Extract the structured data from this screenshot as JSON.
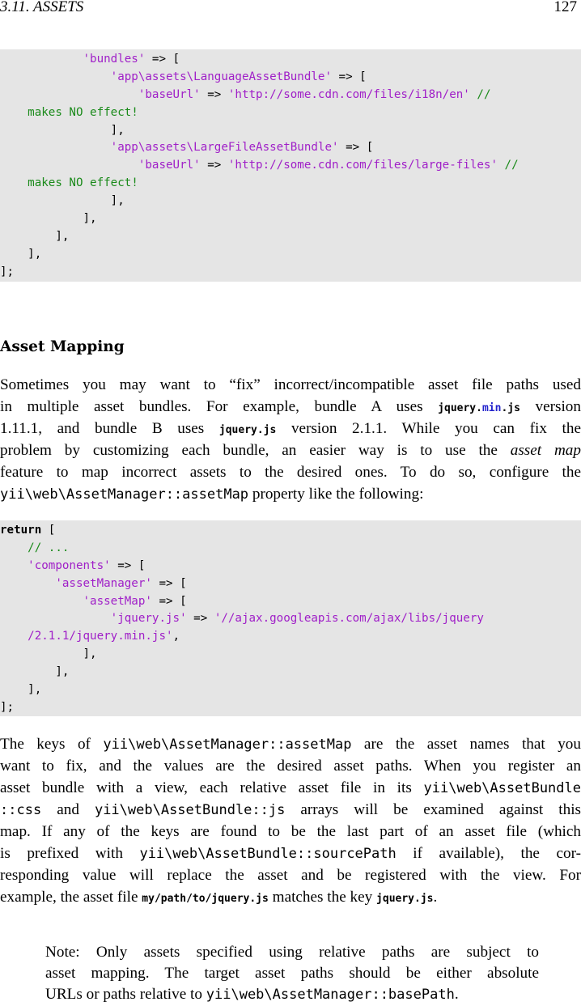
{
  "header": {
    "section": "3.11. ASSETS",
    "page": "127"
  },
  "code1": [
    {
      "segs": [
        {
          "t": "            "
        },
        {
          "t": "'bundles'",
          "c": "str"
        },
        {
          "t": " => ["
        }
      ]
    },
    {
      "segs": [
        {
          "t": "                "
        },
        {
          "t": "'app\\assets\\LanguageAssetBundle'",
          "c": "str"
        },
        {
          "t": " => ["
        }
      ]
    },
    {
      "segs": [
        {
          "t": "                    "
        },
        {
          "t": "'baseUrl'",
          "c": "str"
        },
        {
          "t": " => "
        },
        {
          "t": "'http://some.cdn.com/files/i18n/en'",
          "c": "str"
        },
        {
          "t": " //",
          "c": "cmt"
        }
      ]
    },
    {
      "segs": [
        {
          "t": "    "
        },
        {
          "t": "makes NO effect!",
          "c": "cmt"
        }
      ]
    },
    {
      "segs": [
        {
          "t": "                ],"
        }
      ]
    },
    {
      "segs": [
        {
          "t": "                "
        },
        {
          "t": "'app\\assets\\LargeFileAssetBundle'",
          "c": "str"
        },
        {
          "t": " => ["
        }
      ]
    },
    {
      "segs": [
        {
          "t": "                    "
        },
        {
          "t": "'baseUrl'",
          "c": "str"
        },
        {
          "t": " => "
        },
        {
          "t": "'http://some.cdn.com/files/large-files'",
          "c": "str"
        },
        {
          "t": " //",
          "c": "cmt"
        }
      ]
    },
    {
      "segs": [
        {
          "t": "    "
        },
        {
          "t": "makes NO effect!",
          "c": "cmt"
        }
      ]
    },
    {
      "segs": [
        {
          "t": "                ],"
        }
      ]
    },
    {
      "segs": [
        {
          "t": "            ],"
        }
      ]
    },
    {
      "segs": [
        {
          "t": "        ],"
        }
      ]
    },
    {
      "segs": [
        {
          "t": "    ],"
        }
      ]
    },
    {
      "segs": [
        {
          "t": "];"
        }
      ]
    }
  ],
  "heading": "Asset Mapping",
  "para1": [
    {
      "segs": [
        {
          "t": "Sometimes you may want to “fix” incorrect/incompatible asset file paths used"
        }
      ]
    },
    {
      "segs": [
        {
          "t": "in multiple asset bundles. For example, bundle A uses "
        },
        {
          "t": "jquery.",
          "c": "tts"
        },
        {
          "t": "min",
          "c": "tts mn"
        },
        {
          "t": ".js",
          "c": "tts"
        },
        {
          "t": " version"
        }
      ]
    },
    {
      "segs": [
        {
          "t": "1.11.1, and bundle B uses "
        },
        {
          "t": "jquery.js",
          "c": "tts"
        },
        {
          "t": " version 2.1.1. While you can fix the"
        }
      ]
    },
    {
      "segs": [
        {
          "t": "problem by customizing each bundle, an easier way is to use the "
        },
        {
          "t": "asset map",
          "c": "em"
        }
      ]
    },
    {
      "segs": [
        {
          "t": "feature to map incorrect assets to the desired ones. To do so, configure the"
        }
      ]
    },
    {
      "segs": [
        {
          "t": "yii\\web\\AssetManager::assetMap",
          "c": "tt"
        },
        {
          "t": " property like the following:"
        }
      ],
      "last": true
    }
  ],
  "code2": [
    {
      "segs": [
        {
          "t": "return",
          "c": "kw"
        },
        {
          "t": " ["
        }
      ]
    },
    {
      "segs": [
        {
          "t": "    "
        },
        {
          "t": "// ...",
          "c": "cmt"
        }
      ]
    },
    {
      "segs": [
        {
          "t": "    "
        },
        {
          "t": "'components'",
          "c": "str"
        },
        {
          "t": " => ["
        }
      ]
    },
    {
      "segs": [
        {
          "t": "        "
        },
        {
          "t": "'assetManager'",
          "c": "str"
        },
        {
          "t": " => ["
        }
      ]
    },
    {
      "segs": [
        {
          "t": "            "
        },
        {
          "t": "'assetMap'",
          "c": "str"
        },
        {
          "t": " => ["
        }
      ]
    },
    {
      "segs": [
        {
          "t": "                "
        },
        {
          "t": "'jquery.js'",
          "c": "str"
        },
        {
          "t": " => "
        },
        {
          "t": "'//ajax.googleapis.com/ajax/libs/jquery",
          "c": "str"
        }
      ]
    },
    {
      "segs": [
        {
          "t": "    "
        },
        {
          "t": "/2.1.1/jquery.min.js'",
          "c": "str"
        },
        {
          "t": ","
        }
      ]
    },
    {
      "segs": [
        {
          "t": "            ],"
        }
      ]
    },
    {
      "segs": [
        {
          "t": "        ],"
        }
      ]
    },
    {
      "segs": [
        {
          "t": "    ],"
        }
      ]
    },
    {
      "segs": [
        {
          "t": "];"
        }
      ]
    }
  ],
  "para2": [
    {
      "segs": [
        {
          "t": "The keys of "
        },
        {
          "t": "yii\\web\\AssetManager::assetMap",
          "c": "tt"
        },
        {
          "t": " are the asset names that you"
        }
      ]
    },
    {
      "segs": [
        {
          "t": "want to fix, and the values are the desired asset paths. When you register an"
        }
      ]
    },
    {
      "segs": [
        {
          "t": "asset bundle with a view, each relative asset file in its "
        },
        {
          "t": "yii\\web\\AssetBundle",
          "c": "tt"
        }
      ]
    },
    {
      "segs": [
        {
          "t": "::css",
          "c": "tt"
        },
        {
          "t": " and "
        },
        {
          "t": "yii\\web\\AssetBundle::js",
          "c": "tt"
        },
        {
          "t": " arrays will be examined against this"
        }
      ]
    },
    {
      "segs": [
        {
          "t": "map. If any of the keys are found to be the last part of an asset file (which"
        }
      ]
    },
    {
      "segs": [
        {
          "t": "is prefixed with "
        },
        {
          "t": "yii\\web\\AssetBundle::sourcePath",
          "c": "tt"
        },
        {
          "t": " if available), the cor-"
        }
      ]
    },
    {
      "segs": [
        {
          "t": "responding value will replace the asset and be registered with the view. For"
        }
      ]
    },
    {
      "segs": [
        {
          "t": "example, the asset file "
        },
        {
          "t": "my/path/to/jquery.js",
          "c": "tts"
        },
        {
          "t": " matches the key "
        },
        {
          "t": "jquery.js",
          "c": "tts"
        },
        {
          "t": "."
        }
      ],
      "last": true
    }
  ],
  "note": [
    {
      "segs": [
        {
          "t": "Note:",
          "c": "b"
        },
        {
          "t": " Only assets specified using relative paths are subject to"
        }
      ]
    },
    {
      "segs": [
        {
          "t": "asset mapping. The target asset paths should be either absolute"
        }
      ]
    },
    {
      "segs": [
        {
          "t": "URLs or paths relative to "
        },
        {
          "t": "yii\\web\\AssetManager::basePath",
          "c": "tt"
        },
        {
          "t": "."
        }
      ],
      "last": true
    }
  ]
}
